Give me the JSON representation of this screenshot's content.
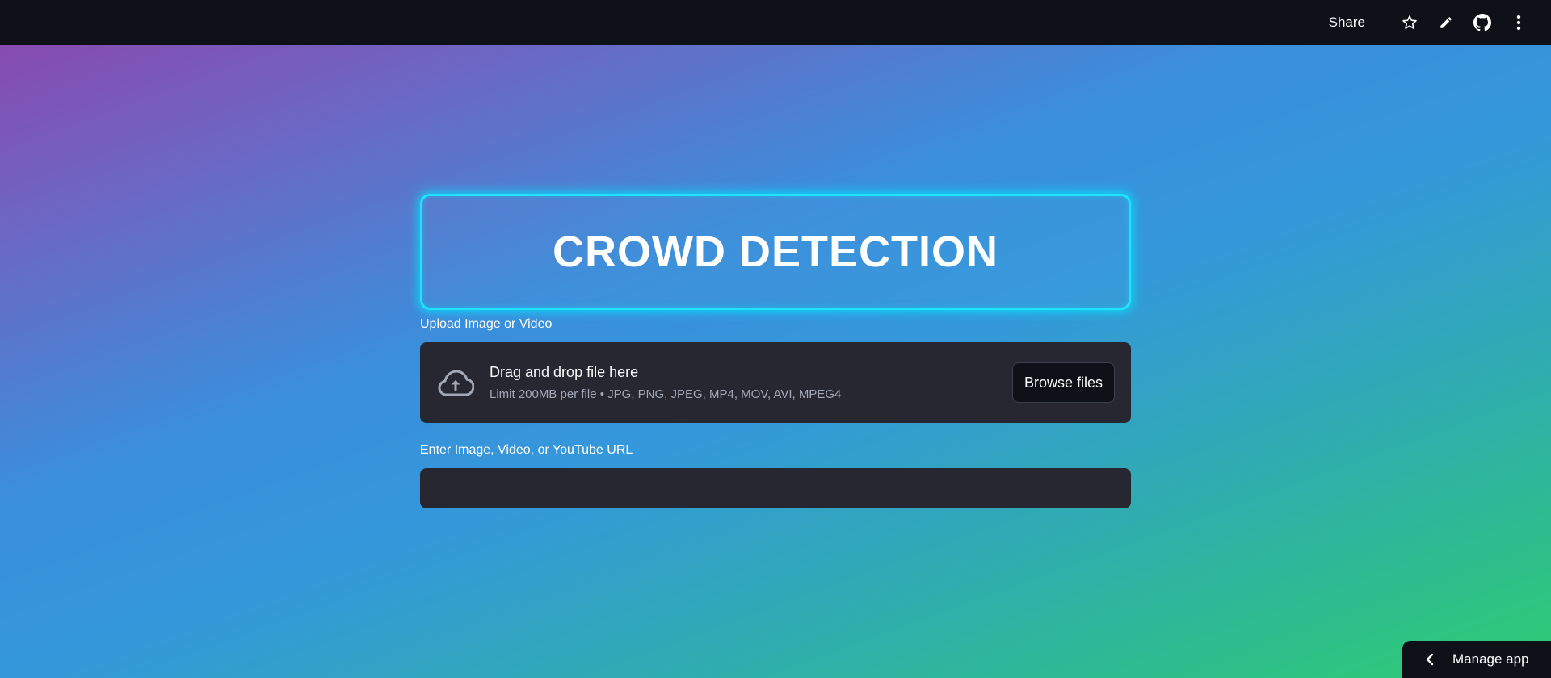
{
  "topbar": {
    "share_label": "Share",
    "icons": [
      "star-icon",
      "pencil-icon",
      "github-icon",
      "more-vertical-icon"
    ]
  },
  "main": {
    "title": "CROWD DETECTION",
    "title_glow_color": "#1fe3ff",
    "uploader": {
      "label": "Upload Image or Video",
      "drop_text": "Drag and drop file here",
      "limit_text": "Limit 200MB per file • JPG, PNG, JPEG, MP4, MOV, AVI, MPEG4",
      "browse_label": "Browse files",
      "icon": "cloud-upload-icon"
    },
    "url_field": {
      "label": "Enter Image, Video, or YouTube URL",
      "value": "",
      "placeholder": ""
    }
  },
  "footer": {
    "manage_app_label": "Manage app"
  },
  "colors": {
    "topbar_bg": "#0e1118",
    "panel_bg": "#262730",
    "gradient": [
      "#8e44ad",
      "#3498db",
      "#2ecc71"
    ]
  }
}
